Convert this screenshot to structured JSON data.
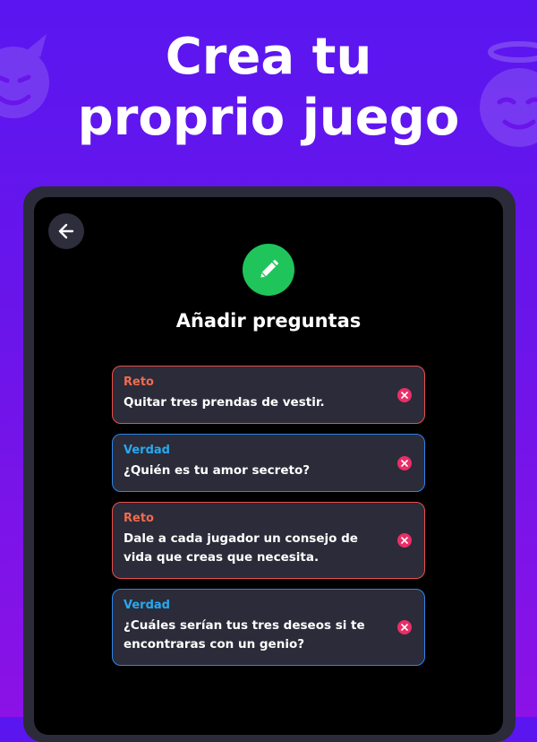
{
  "headline": {
    "line1": "Crea tu",
    "line2": "proprio juego"
  },
  "screen": {
    "title": "Añadir preguntas"
  },
  "icons": {
    "back": "arrow-left-icon",
    "edit": "pencil-icon",
    "remove": "close-icon",
    "decor_left": "devil-face-icon",
    "decor_right": "angel-face-icon"
  },
  "colors": {
    "background": "#6a15ea",
    "reto": "#f06b4f",
    "verdad": "#26a9f0",
    "accent_green": "#1fc55a",
    "remove": "#ea2e67"
  },
  "cards": [
    {
      "type": "Reto",
      "text": "Quitar tres prendas de vestir."
    },
    {
      "type": "Verdad",
      "text": "¿Quién es tu amor secreto?"
    },
    {
      "type": "Reto",
      "text": "Dale a cada jugador un consejo de vida que creas que necesita."
    },
    {
      "type": "Verdad",
      "text": "¿Cuáles serían tus tres deseos si te encontraras con un genio?"
    }
  ]
}
